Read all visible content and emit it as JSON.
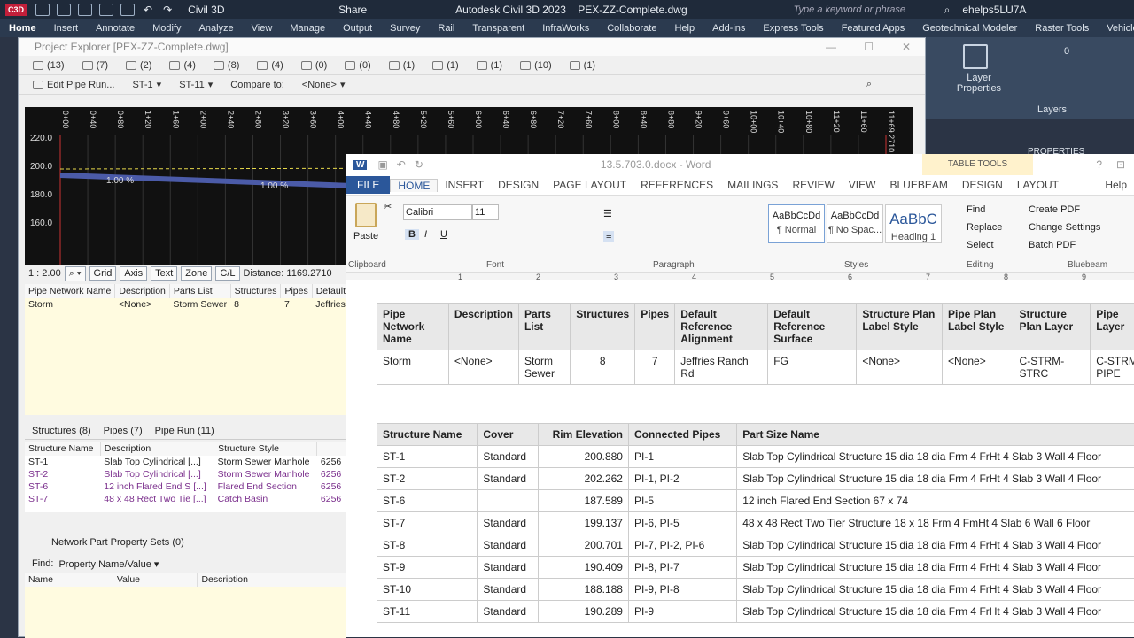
{
  "c3d": {
    "logo": "C3D",
    "workspace": "Civil 3D",
    "share": "Share",
    "title": "Autodesk Civil 3D 2023    PEX-ZZ-Complete.dwg",
    "search_placeholder": "Type a keyword or phrase",
    "user": "ehelps5LU7A",
    "tabs": [
      "Home",
      "Insert",
      "Annotate",
      "Modify",
      "Analyze",
      "View",
      "Manage",
      "Output",
      "Survey",
      "Rail",
      "Transparent",
      "InfraWorks",
      "Collaborate",
      "Help",
      "Add-ins",
      "Express Tools",
      "Featured Apps",
      "Geotechnical Modeler",
      "Raster Tools",
      "Vehicle Tracking"
    ],
    "layer_props": "Layer\nProperties",
    "layers": "Layers",
    "layer_value": "0",
    "properties": "PROPERTIES"
  },
  "pex": {
    "title": "Project Explorer [PEX-ZZ-Complete.dwg]",
    "counts": [
      "(13)",
      "(7)",
      "(2)",
      "(4)",
      "(8)",
      "(4)",
      "(0)",
      "(0)",
      "(1)",
      "(1)",
      "(1)",
      "(10)",
      "(1)"
    ],
    "edit_pipe_run": "Edit Pipe Run...",
    "st_from": "ST-1",
    "st_to": "ST-11",
    "compare_to": "Compare to:",
    "compare_value": "<None>",
    "x_ticks": [
      "0+00",
      "0+40",
      "0+80",
      "1+20",
      "1+60",
      "2+00",
      "2+40",
      "2+80",
      "3+20",
      "3+60",
      "4+00",
      "4+40",
      "4+80",
      "5+20",
      "5+60",
      "6+00",
      "6+40",
      "6+80",
      "7+20",
      "7+60",
      "8+00",
      "8+40",
      "8+80",
      "9+20",
      "9+60",
      "10+00",
      "10+40",
      "10+80",
      "11+20",
      "11+60",
      "11+69.2710"
    ],
    "y_ticks": [
      "220.0",
      "200.0",
      "180.0",
      "160.0"
    ],
    "slope1": "1.00 %",
    "slope2": "1.00 %",
    "scale": "1 : 2.00",
    "grid": "Grid",
    "axis": "Axis",
    "text": "Text",
    "zone": "Zone",
    "cl": "C/L",
    "distance": "Distance: 1169.2710",
    "net_headers": [
      "Pipe Network Name",
      "Description",
      "Parts List",
      "Structures",
      "Pipes",
      "Default Ref"
    ],
    "net_row": [
      "Storm",
      "<None>",
      "Storm Sewer",
      "8",
      "7",
      "Jeffries Ran"
    ],
    "tabs": [
      "Structures (8)",
      "Pipes (7)",
      "Pipe Run (11)"
    ],
    "struct_headers": [
      "Structure Name",
      "Description",
      "Structure Style",
      ""
    ],
    "struct_rows": [
      [
        "ST-1",
        "Slab Top Cylindrical [...]",
        "Storm Sewer Manhole",
        "6256"
      ],
      [
        "ST-2",
        "Slab Top Cylindrical [...]",
        "Storm Sewer Manhole",
        "6256"
      ],
      [
        "ST-6",
        "12 inch Flared End S [...]",
        "Flared End Section",
        "6256"
      ],
      [
        "ST-7",
        "48 x 48 Rect Two Tie [...]",
        "Catch Basin",
        "6256"
      ]
    ],
    "prop_sets": "Network Part Property Sets (0)",
    "find": "Find:",
    "find_value": "Property Name/Value",
    "prop_headers": [
      "Name",
      "Value",
      "Description"
    ]
  },
  "word": {
    "doc_title": "13.5.703.0.docx - Word",
    "table_tools": "TABLE TOOLS",
    "tabs": [
      "FILE",
      "HOME",
      "INSERT",
      "DESIGN",
      "PAGE LAYOUT",
      "REFERENCES",
      "MAILINGS",
      "REVIEW",
      "VIEW",
      "BLUEBEAM",
      "DESIGN",
      "LAYOUT"
    ],
    "help": "Help",
    "font": "Calibri",
    "size": "11",
    "paste": "Paste",
    "groups": [
      "Clipboard",
      "Font",
      "Paragraph",
      "Styles",
      "Editing",
      "Bluebeam"
    ],
    "styles": [
      {
        "sample": "AaBbCcDd",
        "name": "¶ Normal"
      },
      {
        "sample": "AaBbCcDd",
        "name": "¶ No Spac..."
      },
      {
        "sample": "AaBbC",
        "name": "Heading 1"
      }
    ],
    "editing": [
      "Find",
      "Replace",
      "Select"
    ],
    "bluebeam": [
      "Create PDF",
      "Change Settings",
      "Batch PDF"
    ],
    "ruler": [
      "1",
      "2",
      "3",
      "4",
      "5",
      "6",
      "7",
      "8",
      "9"
    ],
    "t1_headers": [
      "Pipe Network Name",
      "Description",
      "Parts List",
      "Structures",
      "Pipes",
      "Default Reference Alignment",
      "Default Reference Surface",
      "Structure Plan Label Style",
      "Pipe Plan Label Style",
      "Structure Plan Layer",
      "Pipe Layer"
    ],
    "t1_row": [
      "Storm",
      "<None>",
      "Storm Sewer",
      "8",
      "7",
      "Jeffries Ranch Rd",
      "FG",
      "<None>",
      "<None>",
      "C-STRM-STRC",
      "C-STRM-PIPE"
    ],
    "t2_headers": [
      "Structure Name",
      "Cover",
      "Rim Elevation",
      "Connected Pipes",
      "Part Size Name"
    ],
    "t2_rows": [
      [
        "ST-1",
        "Standard",
        "200.880",
        "PI-1",
        "Slab Top Cylindrical Structure 15 dia 18 dia Frm 4 FrHt 4 Slab 3 Wall 4 Floor"
      ],
      [
        "ST-2",
        "Standard",
        "202.262",
        "PI-1, PI-2",
        "Slab Top Cylindrical Structure 15 dia 18 dia Frm 4 FrHt 4 Slab 3 Wall 4 Floor"
      ],
      [
        "ST-6",
        "",
        "187.589",
        "PI-5",
        "12 inch Flared End Section  67 x 74"
      ],
      [
        "ST-7",
        "Standard",
        "199.137",
        "PI-6, PI-5",
        "48 x 48 Rect Two Tier Structure 18 x 18 Frm 4 FmHt 4 Slab 6 Wall 6 Floor"
      ],
      [
        "ST-8",
        "Standard",
        "200.701",
        "PI-7, PI-2, PI-6",
        "Slab Top Cylindrical Structure 15 dia 18 dia Frm 4 FrHt 4 Slab 3 Wall 4 Floor"
      ],
      [
        "ST-9",
        "Standard",
        "190.409",
        "PI-8, PI-7",
        "Slab Top Cylindrical Structure 15 dia 18 dia Frm 4 FrHt 4 Slab 3 Wall 4 Floor"
      ],
      [
        "ST-10",
        "Standard",
        "188.188",
        "PI-9, PI-8",
        "Slab Top Cylindrical Structure 15 dia 18 dia Frm 4 FrHt 4 Slab 3 Wall 4 Floor"
      ],
      [
        "ST-11",
        "Standard",
        "190.289",
        "PI-9",
        "Slab Top Cylindrical Structure 15 dia 18 dia Frm 4 FrHt 4 Slab 3 Wall 4 Floor"
      ]
    ]
  }
}
